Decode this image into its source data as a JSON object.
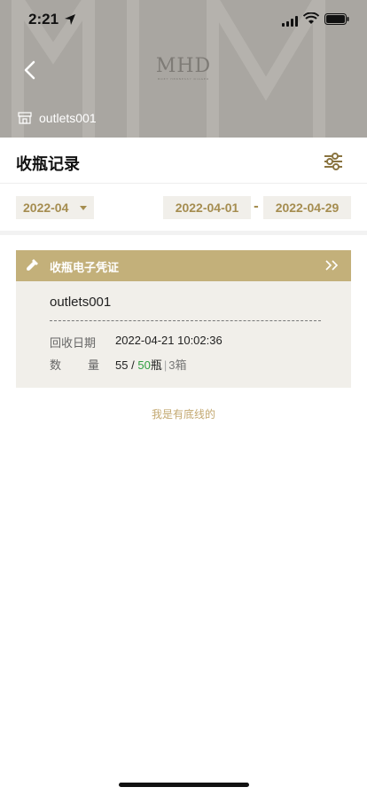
{
  "status_bar": {
    "time": "2:21"
  },
  "header": {
    "logo_text": "MHD",
    "logo_sub": "MOET HENNESSY DIAGEO",
    "store_name": "outlets001"
  },
  "page": {
    "title": "收瓶记录"
  },
  "date_filter": {
    "month": "2022-04",
    "start_date": "2022-04-01",
    "separator": "-",
    "end_date": "2022-04-29"
  },
  "records": [
    {
      "header_title": "收瓶电子凭证",
      "store": "outlets001",
      "date_label": "回收日期",
      "date_value": "2022-04-21 10:02:36",
      "qty_label_1": "数",
      "qty_label_2": "量",
      "qty_collected": "55",
      "qty_slash": "/",
      "qty_total": "50",
      "qty_unit": "瓶",
      "qty_sep": "|",
      "qty_boxes": "3箱"
    }
  ],
  "footer": {
    "end_text": "我是有底线的"
  },
  "colors": {
    "accent": "#a58d50",
    "card_header": "#c3b07a",
    "card_bg": "#f1efea",
    "banner_bg": "#a9a6a1",
    "green": "#2e9e3f"
  }
}
